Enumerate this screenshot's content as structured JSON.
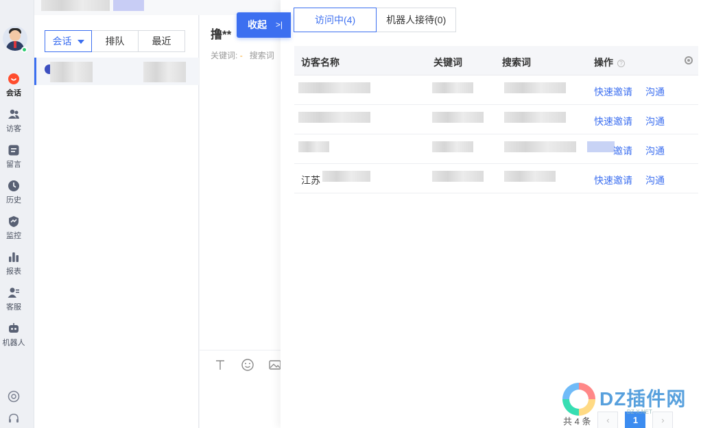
{
  "nav": {
    "items": [
      {
        "label": "会话",
        "icon": "chat-icon"
      },
      {
        "label": "访客",
        "icon": "visitors-icon"
      },
      {
        "label": "留言",
        "icon": "message-icon"
      },
      {
        "label": "历史",
        "icon": "history-icon"
      },
      {
        "label": "监控",
        "icon": "monitor-icon"
      },
      {
        "label": "报表",
        "icon": "report-icon"
      },
      {
        "label": "客服",
        "icon": "agent-icon"
      },
      {
        "label": "机器人",
        "icon": "robot-icon"
      }
    ]
  },
  "session_list": {
    "tabs": [
      "会话",
      "排队",
      "最近"
    ]
  },
  "chat": {
    "title": "撸**",
    "keywords_label": "关键词:",
    "keywords_value": "-",
    "search_label": "搜索词"
  },
  "collapse": {
    "label": "收起",
    "chevron": ">|"
  },
  "drawer": {
    "tabs": [
      "访问中(4)",
      "机器人接待(0)"
    ],
    "columns": [
      "访客名称",
      "关键词",
      "搜索词",
      "操作"
    ],
    "rows": [
      {
        "name": "",
        "invite": "快速邀请",
        "chat": "沟通"
      },
      {
        "name": "",
        "invite": "快速邀请",
        "chat": "沟通"
      },
      {
        "name": "",
        "invite": "邀请",
        "chat": "沟通"
      },
      {
        "name": "江苏",
        "invite": "快速邀请",
        "chat": "沟通"
      }
    ],
    "pagination": {
      "total_text": "共 4 条",
      "current_page": "1",
      "prev": "‹",
      "next": "›"
    }
  },
  "watermark": {
    "text": "DZ插件网",
    "sub": "DZ-X.NET"
  }
}
